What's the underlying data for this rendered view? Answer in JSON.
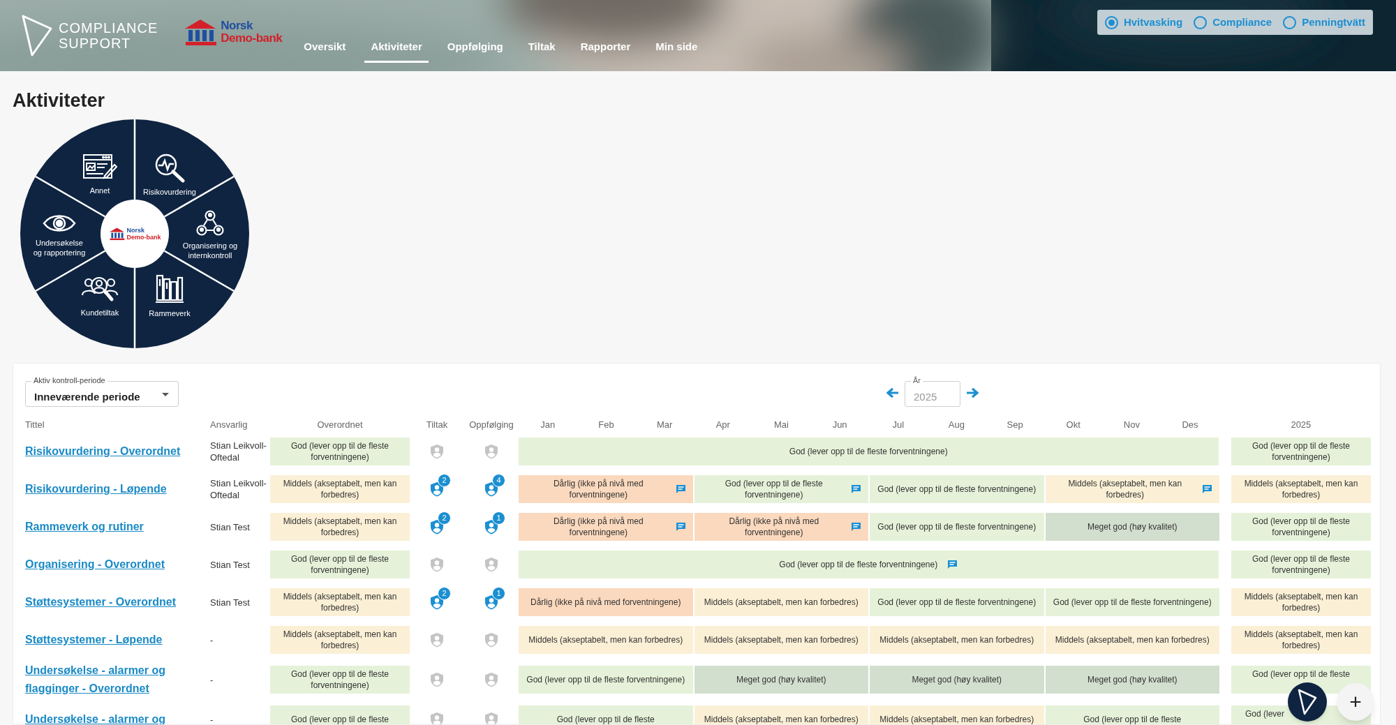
{
  "header": {
    "brand": [
      "COMPLIANCE",
      "SUPPORT"
    ],
    "bank_logo": [
      "Norsk",
      "Demo-bank"
    ],
    "nav": [
      {
        "label": "Oversikt",
        "selected": false
      },
      {
        "label": "Aktiviteter",
        "selected": true
      },
      {
        "label": "Oppfølging",
        "selected": false
      },
      {
        "label": "Tiltak",
        "selected": false
      },
      {
        "label": "Rapporter",
        "selected": false
      },
      {
        "label": "Min side",
        "selected": false
      }
    ],
    "modes": [
      {
        "label": "Hvitvasking",
        "selected": true
      },
      {
        "label": "Compliance",
        "selected": false
      },
      {
        "label": "Penningtvätt",
        "selected": false
      }
    ]
  },
  "page_title": "Aktiviteter",
  "wheel": {
    "center_logo": [
      "Norsk",
      "Demo-bank"
    ],
    "segments": [
      {
        "label": "Annet"
      },
      {
        "label": "Risikovurdering"
      },
      {
        "label": "Organisering og internkontroll"
      },
      {
        "label": "Rammeverk"
      },
      {
        "label": "Kundetiltak"
      },
      {
        "label": "Undersøkelse og rapportering"
      }
    ]
  },
  "period_select": {
    "label": "Aktiv kontroll-periode",
    "value": "Inneværende periode"
  },
  "year_field": {
    "label": "År",
    "value": "2025"
  },
  "table": {
    "columns": [
      "Tittel",
      "Ansvarlig",
      "Overordnet",
      "Tiltak",
      "Oppfølging",
      "Jan",
      "Feb",
      "Mar",
      "Apr",
      "Mai",
      "Jun",
      "Jul",
      "Aug",
      "Sep",
      "Okt",
      "Nov",
      "Des",
      "2025"
    ],
    "rows": [
      {
        "title": "Risikovurdering - Overordnet",
        "responsible": "Stian Leikvoll-Oftedal",
        "overall": {
          "kind": "god",
          "text": "God (lever opp til de fleste forventningene)"
        },
        "tiltak": {
          "active": false
        },
        "followup": {
          "active": false
        },
        "timeline": {
          "kind": "year",
          "segments": [
            {
              "kind": "god",
              "text": "God (lever opp til de fleste forventningene)",
              "comment": false
            }
          ]
        },
        "year": {
          "kind": "god",
          "text": "God (lever opp til de fleste forventningene)"
        }
      },
      {
        "title": "Risikovurdering - Løpende",
        "responsible": "Stian Leikvoll-Oftedal",
        "overall": {
          "kind": "middels",
          "text": "Middels (akseptabelt, men kan forbedres)"
        },
        "tiltak": {
          "active": true,
          "count": "2"
        },
        "followup": {
          "active": true,
          "count": "4"
        },
        "timeline": {
          "kind": "quarters",
          "segments": [
            {
              "kind": "darlig",
              "text": "Dårlig (ikke på nivå med forventningene)",
              "comment": true
            },
            {
              "kind": "god",
              "text": "God (lever opp til de fleste forventningene)",
              "comment": true
            },
            {
              "kind": "god",
              "text": "God (lever opp til de fleste forventningene)",
              "comment": false
            },
            {
              "kind": "middels",
              "text": "Middels (akseptabelt, men kan forbedres)",
              "comment": true
            }
          ]
        },
        "year": {
          "kind": "middels",
          "text": "Middels (akseptabelt, men kan forbedres)"
        }
      },
      {
        "title": "Rammeverk og rutiner",
        "responsible": "Stian Test",
        "overall": {
          "kind": "middels",
          "text": "Middels (akseptabelt, men kan forbedres)"
        },
        "tiltak": {
          "active": true,
          "count": "2"
        },
        "followup": {
          "active": true,
          "count": "1"
        },
        "timeline": {
          "kind": "quarters",
          "segments": [
            {
              "kind": "darlig",
              "text": "Dårlig (ikke på nivå med forventningene)",
              "comment": true
            },
            {
              "kind": "darlig",
              "text": "Dårlig (ikke på nivå med forventningene)",
              "comment": true
            },
            {
              "kind": "god",
              "text": "God (lever opp til de fleste forventningene)",
              "comment": false
            },
            {
              "kind": "meget_god",
              "text": "Meget god (høy kvalitet)",
              "comment": false
            }
          ]
        },
        "year": {
          "kind": "god",
          "text": "God (lever opp til de fleste forventningene)"
        }
      },
      {
        "title": "Organisering - Overordnet",
        "responsible": "Stian Test",
        "overall": {
          "kind": "god",
          "text": "God (lever opp til de fleste forventningene)"
        },
        "tiltak": {
          "active": false
        },
        "followup": {
          "active": false
        },
        "timeline": {
          "kind": "year",
          "segments": [
            {
              "kind": "god",
              "text": "God (lever opp til de fleste forventningene)",
              "comment": true
            }
          ]
        },
        "year": {
          "kind": "god",
          "text": "God (lever opp til de fleste forventningene)"
        }
      },
      {
        "title": "Støttesystemer - Overordnet",
        "responsible": "Stian Test",
        "overall": {
          "kind": "middels",
          "text": "Middels (akseptabelt, men kan forbedres)"
        },
        "tiltak": {
          "active": true,
          "count": "2"
        },
        "followup": {
          "active": true,
          "count": "1"
        },
        "timeline": {
          "kind": "quarters",
          "segments": [
            {
              "kind": "darlig",
              "text": "Dårlig (ikke på nivå med forventningene)",
              "comment": false
            },
            {
              "kind": "middels",
              "text": "Middels (akseptabelt, men kan forbedres)",
              "comment": false
            },
            {
              "kind": "god",
              "text": "God (lever opp til de fleste forventningene)",
              "comment": false
            },
            {
              "kind": "god",
              "text": "God (lever opp til de fleste forventningene)",
              "comment": false
            }
          ]
        },
        "year": {
          "kind": "middels",
          "text": "Middels (akseptabelt, men kan forbedres)"
        }
      },
      {
        "title": "Støttesystemer - Løpende",
        "responsible": "-",
        "overall": {
          "kind": "middels",
          "text": "Middels (akseptabelt, men kan forbedres)"
        },
        "tiltak": {
          "active": false
        },
        "followup": {
          "active": false
        },
        "timeline": {
          "kind": "quarters",
          "segments": [
            {
              "kind": "middels",
              "text": "Middels (akseptabelt, men kan forbedres)",
              "comment": false
            },
            {
              "kind": "middels",
              "text": "Middels (akseptabelt, men kan forbedres)",
              "comment": false
            },
            {
              "kind": "middels",
              "text": "Middels (akseptabelt, men kan forbedres)",
              "comment": false
            },
            {
              "kind": "middels",
              "text": "Middels (akseptabelt, men kan forbedres)",
              "comment": false
            }
          ]
        },
        "year": {
          "kind": "middels",
          "text": "Middels (akseptabelt, men kan forbedres)"
        }
      },
      {
        "title": "Undersøkelse - alarmer og flagginger - Overordnet",
        "responsible": "-",
        "overall": {
          "kind": "god",
          "text": "God (lever opp til de fleste forventningene)"
        },
        "tiltak": {
          "active": false
        },
        "followup": {
          "active": false
        },
        "timeline": {
          "kind": "quarters",
          "segments": [
            {
              "kind": "god",
              "text": "God (lever opp til de fleste forventningene)",
              "comment": false
            },
            {
              "kind": "meget_god",
              "text": "Meget god (høy kvalitet)",
              "comment": false
            },
            {
              "kind": "meget_god",
              "text": "Meget god (høy kvalitet)",
              "comment": false
            },
            {
              "kind": "meget_god",
              "text": "Meget god (høy kvalitet)",
              "comment": false
            }
          ]
        },
        "year": {
          "kind": "god",
          "text": "God (lever opp til de fleste"
        }
      },
      {
        "title": "Undersøkelse - alarmer og",
        "responsible": "-",
        "overall": {
          "kind": "god",
          "text": "God (lever opp til de fleste"
        },
        "tiltak": {
          "active": false
        },
        "followup": {
          "active": false
        },
        "timeline": {
          "kind": "quarters",
          "segments": [
            {
              "kind": "god",
              "text": "God (lever opp til de fleste",
              "comment": false
            },
            {
              "kind": "middels",
              "text": "Middels (akseptabelt, men kan forbedres)",
              "comment": false
            },
            {
              "kind": "middels",
              "text": "Middels (akseptabelt, men kan forbedres)",
              "comment": false
            },
            {
              "kind": "god",
              "text": "God (lever opp til de fleste",
              "comment": false
            }
          ]
        },
        "year": {
          "kind": "god",
          "text": "God (lever"
        }
      }
    ]
  },
  "fab": {
    "add": "+"
  }
}
